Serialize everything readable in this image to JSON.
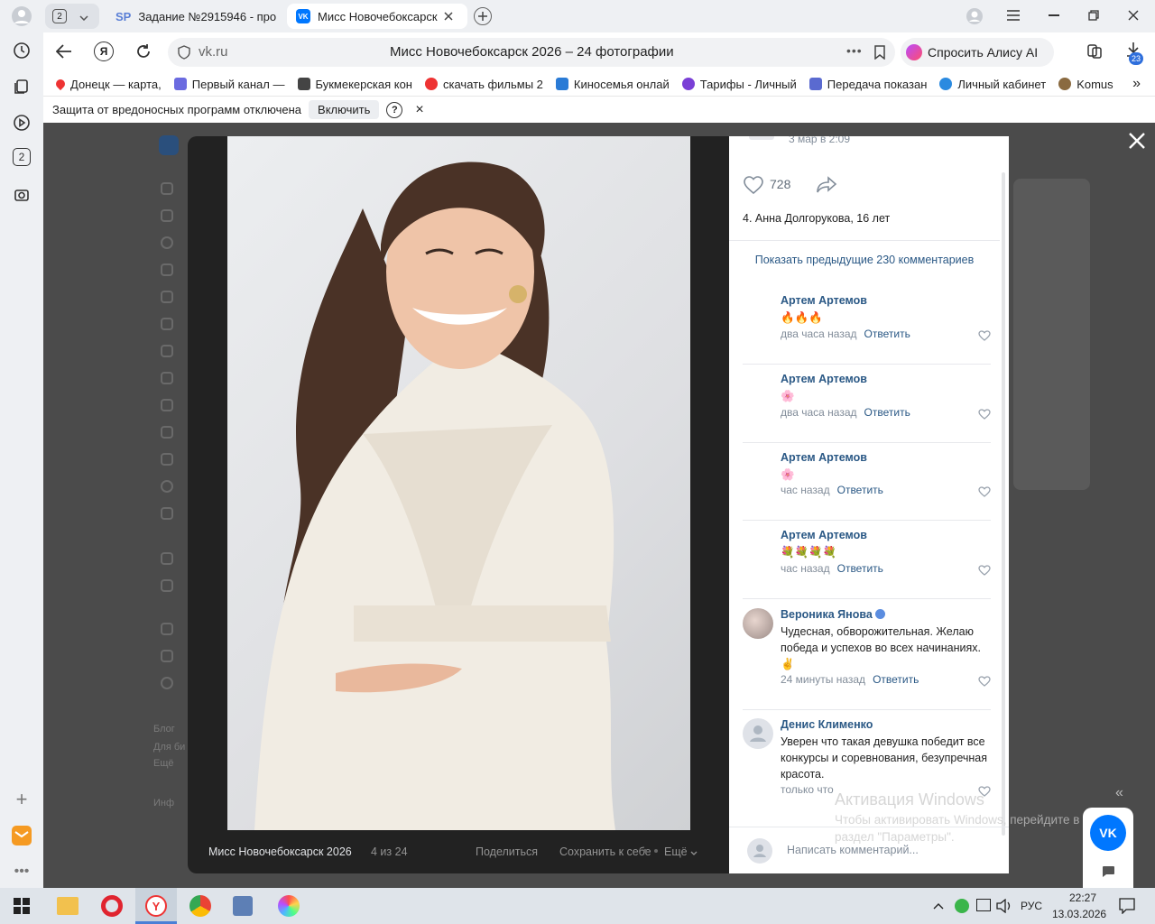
{
  "browser": {
    "tab_count_badge": "2",
    "tabs": [
      {
        "label": "Задание №2915946 - про",
        "favicon_text": "SP"
      },
      {
        "label": "Мисс Новочебоксарск",
        "favicon_text": "VK"
      }
    ],
    "address": "vk.ru",
    "page_title": "Мисс Новочебоксарск 2026 – 24 фотографии",
    "alice_label": "Спросить Алису AI",
    "downloads_badge": "23",
    "rail_badge": "2",
    "bookmarks": [
      "Донецк — карта,",
      "Первый канал —",
      "Букмекерская кон",
      "скачать фильмы 2",
      "Киносемья онлай",
      "Тарифы - Личный",
      "Передача показан",
      "Личный кабинет",
      "Komus"
    ],
    "infobar": {
      "text": "Защита от вредоносных программ отключена",
      "button": "Включить",
      "help": "?",
      "close": "×"
    }
  },
  "viewer": {
    "close": "×",
    "album": "Мисс Новочебоксарск 2026",
    "counter": "4 из 24",
    "share": "Поделиться",
    "save": "Сохранить к себе",
    "more": "Ещё",
    "post_date": "3 мар в 2:09",
    "likes": "728",
    "caption": "4. Анна Долгорукова, 16 лет",
    "show_previous": "Показать предыдущие 230 комментариев",
    "comments": [
      {
        "author": "Артем Артемов",
        "text": "🔥🔥🔥",
        "time": "два часа назад",
        "reply": "Ответить"
      },
      {
        "author": "Артем Артемов",
        "text": "🌸",
        "time": "два часа назад",
        "reply": "Ответить"
      },
      {
        "author": "Артем Артемов",
        "text": "🌸",
        "time": "час назад",
        "reply": "Ответить"
      },
      {
        "author": "Артем Артемов",
        "text": "💐💐💐💐",
        "time": "час назад",
        "reply": "Ответить"
      },
      {
        "author": "Вероника Янова",
        "text": "Чудесная, обворожительная. Желаю победа и успехов во всех начинаниях.✌",
        "time": "24 минуты назад",
        "reply": "Ответить"
      },
      {
        "author": "Денис Клименко",
        "text": "Уверен что такая девушка победит все конкурсы и соревнования, безупречная красота.",
        "time": "только что",
        "reply": ""
      }
    ],
    "write_placeholder": "Написать комментарий..."
  },
  "behind": {
    "left_text": [
      "Блог",
      "Для би",
      "Ещё",
      "Инф"
    ]
  },
  "watermark": {
    "title": "Активация Windows",
    "line1": "Чтобы активировать Windows, перейдите в",
    "line2": "раздел \"Параметры\"."
  },
  "taskbar": {
    "lang": "РУС",
    "time": "22:27",
    "date": "13.03.2026"
  },
  "colors": {
    "vk_blue": "#0077ff",
    "link": "#2a5885",
    "meta": "#818c99"
  }
}
